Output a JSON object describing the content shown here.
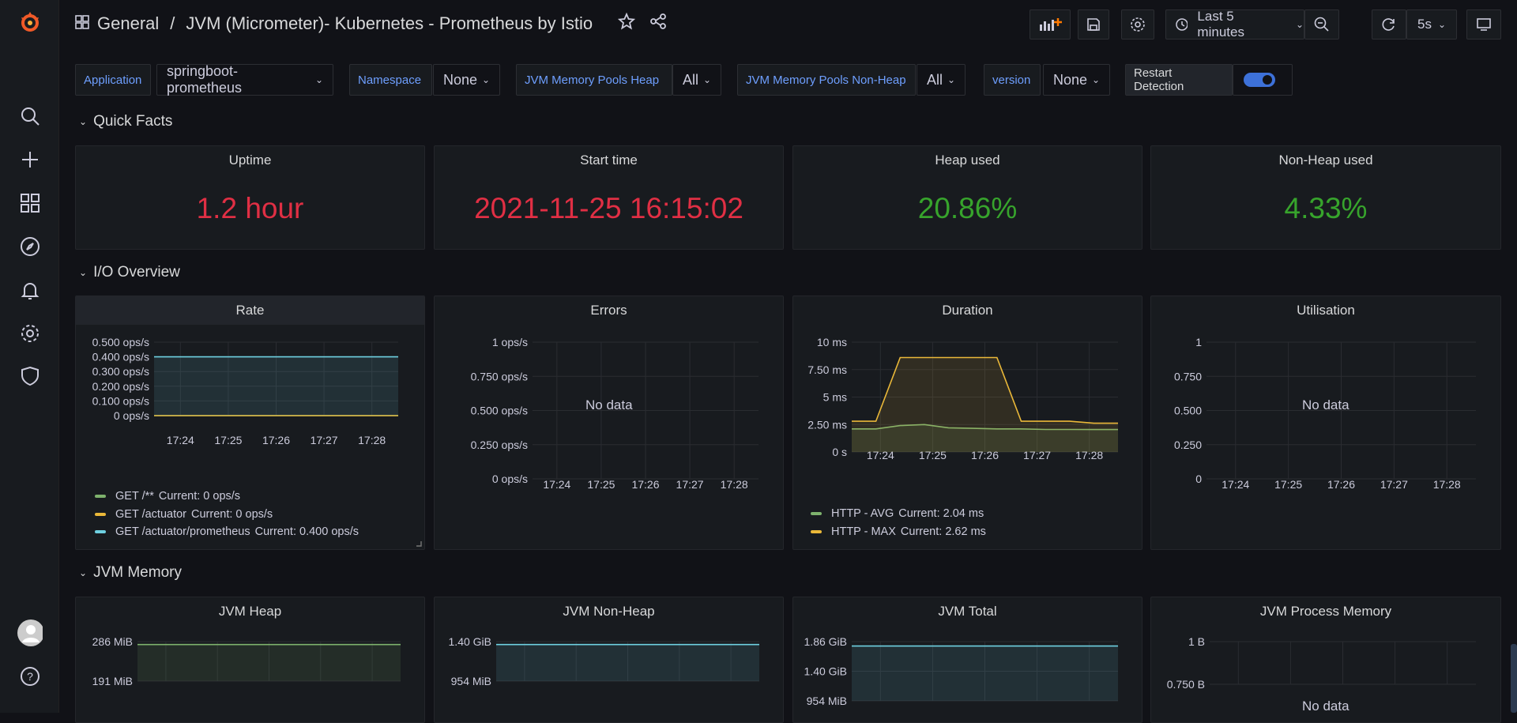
{
  "breadcrumb": {
    "folder": "General",
    "separator": "/",
    "dashboard": "JVM (Micrometer)- Kubernetes - Prometheus by Istio"
  },
  "toolbar": {
    "time_range": "Last 5 minutes",
    "refresh_interval": "5s"
  },
  "variables": [
    {
      "label": "Application",
      "value": "springboot-prometheus"
    },
    {
      "label": "Namespace",
      "value": "None"
    },
    {
      "label": "JVM Memory Pools Heap",
      "value": "All"
    },
    {
      "label": "JVM Memory Pools Non-Heap",
      "value": "All"
    },
    {
      "label": "version",
      "value": "None"
    },
    {
      "label": "Restart Detection",
      "value": "on"
    }
  ],
  "rows": {
    "quick_facts": "Quick Facts",
    "io_overview": "I/O Overview",
    "jvm_memory": "JVM Memory"
  },
  "quick_facts": [
    {
      "title": "Uptime",
      "value": "1.2 hour",
      "color": "#e02f44"
    },
    {
      "title": "Start time",
      "value": "2021-11-25 16:15:02",
      "color": "#e02f44"
    },
    {
      "title": "Heap used",
      "value": "20.86%",
      "color": "#37a42c"
    },
    {
      "title": "Non-Heap used",
      "value": "4.33%",
      "color": "#37a42c"
    }
  ],
  "no_data_text": "No data",
  "colors": {
    "green": "#7eb26d",
    "yellow": "#eab839",
    "cyan": "#6ed0e0",
    "red": "#e02f44",
    "stat_green": "#37a42c"
  },
  "chart_data": [
    {
      "type": "line",
      "title": "Rate",
      "x": [
        "17:24",
        "17:25",
        "17:26",
        "17:27",
        "17:28"
      ],
      "yticks": [
        "0.500 ops/s",
        "0.400 ops/s",
        "0.300 ops/s",
        "0.200 ops/s",
        "0.100 ops/s",
        "0 ops/s"
      ],
      "ylim": [
        0,
        0.5
      ],
      "series": [
        {
          "name": "GET /**",
          "current": "Current: 0 ops/s",
          "color": "#7eb26d",
          "values": [
            0,
            0,
            0,
            0,
            0
          ]
        },
        {
          "name": "GET /actuator",
          "current": "Current: 0 ops/s",
          "color": "#eab839",
          "values": [
            0,
            0,
            0,
            0,
            0
          ]
        },
        {
          "name": "GET /actuator/prometheus",
          "current": "Current: 0.400 ops/s",
          "color": "#6ed0e0",
          "values": [
            0.4,
            0.4,
            0.4,
            0.4,
            0.4
          ]
        }
      ]
    },
    {
      "type": "line",
      "title": "Errors",
      "x": [
        "17:24",
        "17:25",
        "17:26",
        "17:27",
        "17:28"
      ],
      "yticks": [
        "1 ops/s",
        "0.750 ops/s",
        "0.500 ops/s",
        "0.250 ops/s",
        "0 ops/s"
      ],
      "series": []
    },
    {
      "type": "area",
      "title": "Duration",
      "x": [
        "17:24",
        "17:25",
        "17:26",
        "17:27",
        "17:28"
      ],
      "yticks": [
        "10 ms",
        "7.50 ms",
        "5 ms",
        "2.50 ms",
        "0 s"
      ],
      "ylim": [
        0,
        10
      ],
      "series": [
        {
          "name": "HTTP - AVG",
          "current": "Current: 2.04 ms",
          "color": "#7eb26d",
          "values": [
            2.1,
            2.1,
            2.4,
            2.5,
            2.2,
            2.15,
            2.1,
            2.1,
            2.05,
            2.05,
            2.04,
            2.04
          ]
        },
        {
          "name": "HTTP - MAX",
          "current": "Current: 2.62 ms",
          "color": "#eab839",
          "values": [
            2.8,
            2.8,
            8.6,
            8.6,
            8.6,
            8.6,
            8.6,
            2.8,
            2.8,
            2.8,
            2.62,
            2.62
          ]
        }
      ]
    },
    {
      "type": "line",
      "title": "Utilisation",
      "x": [
        "17:24",
        "17:25",
        "17:26",
        "17:27",
        "17:28"
      ],
      "yticks": [
        "1",
        "0.750",
        "0.500",
        "0.250",
        "0"
      ],
      "series": []
    },
    {
      "type": "area",
      "title": "JVM Heap",
      "yticks": [
        "286 MiB",
        "191 MiB"
      ],
      "series": [
        {
          "color": "#7eb26d",
          "values": [
            260,
            260
          ]
        }
      ]
    },
    {
      "type": "area",
      "title": "JVM Non-Heap",
      "yticks": [
        "1.40 GiB",
        "954 MiB"
      ],
      "series": [
        {
          "color": "#6ed0e0",
          "values": [
            1.3,
            1.3
          ]
        }
      ]
    },
    {
      "type": "area",
      "title": "JVM Total",
      "yticks": [
        "1.86 GiB",
        "1.40 GiB",
        "954 MiB"
      ],
      "series": [
        {
          "color": "#6ed0e0",
          "values": [
            1.35,
            1.35
          ]
        }
      ]
    },
    {
      "type": "line",
      "title": "JVM Process Memory",
      "yticks": [
        "1 B",
        "0.750 B"
      ],
      "series": []
    }
  ]
}
